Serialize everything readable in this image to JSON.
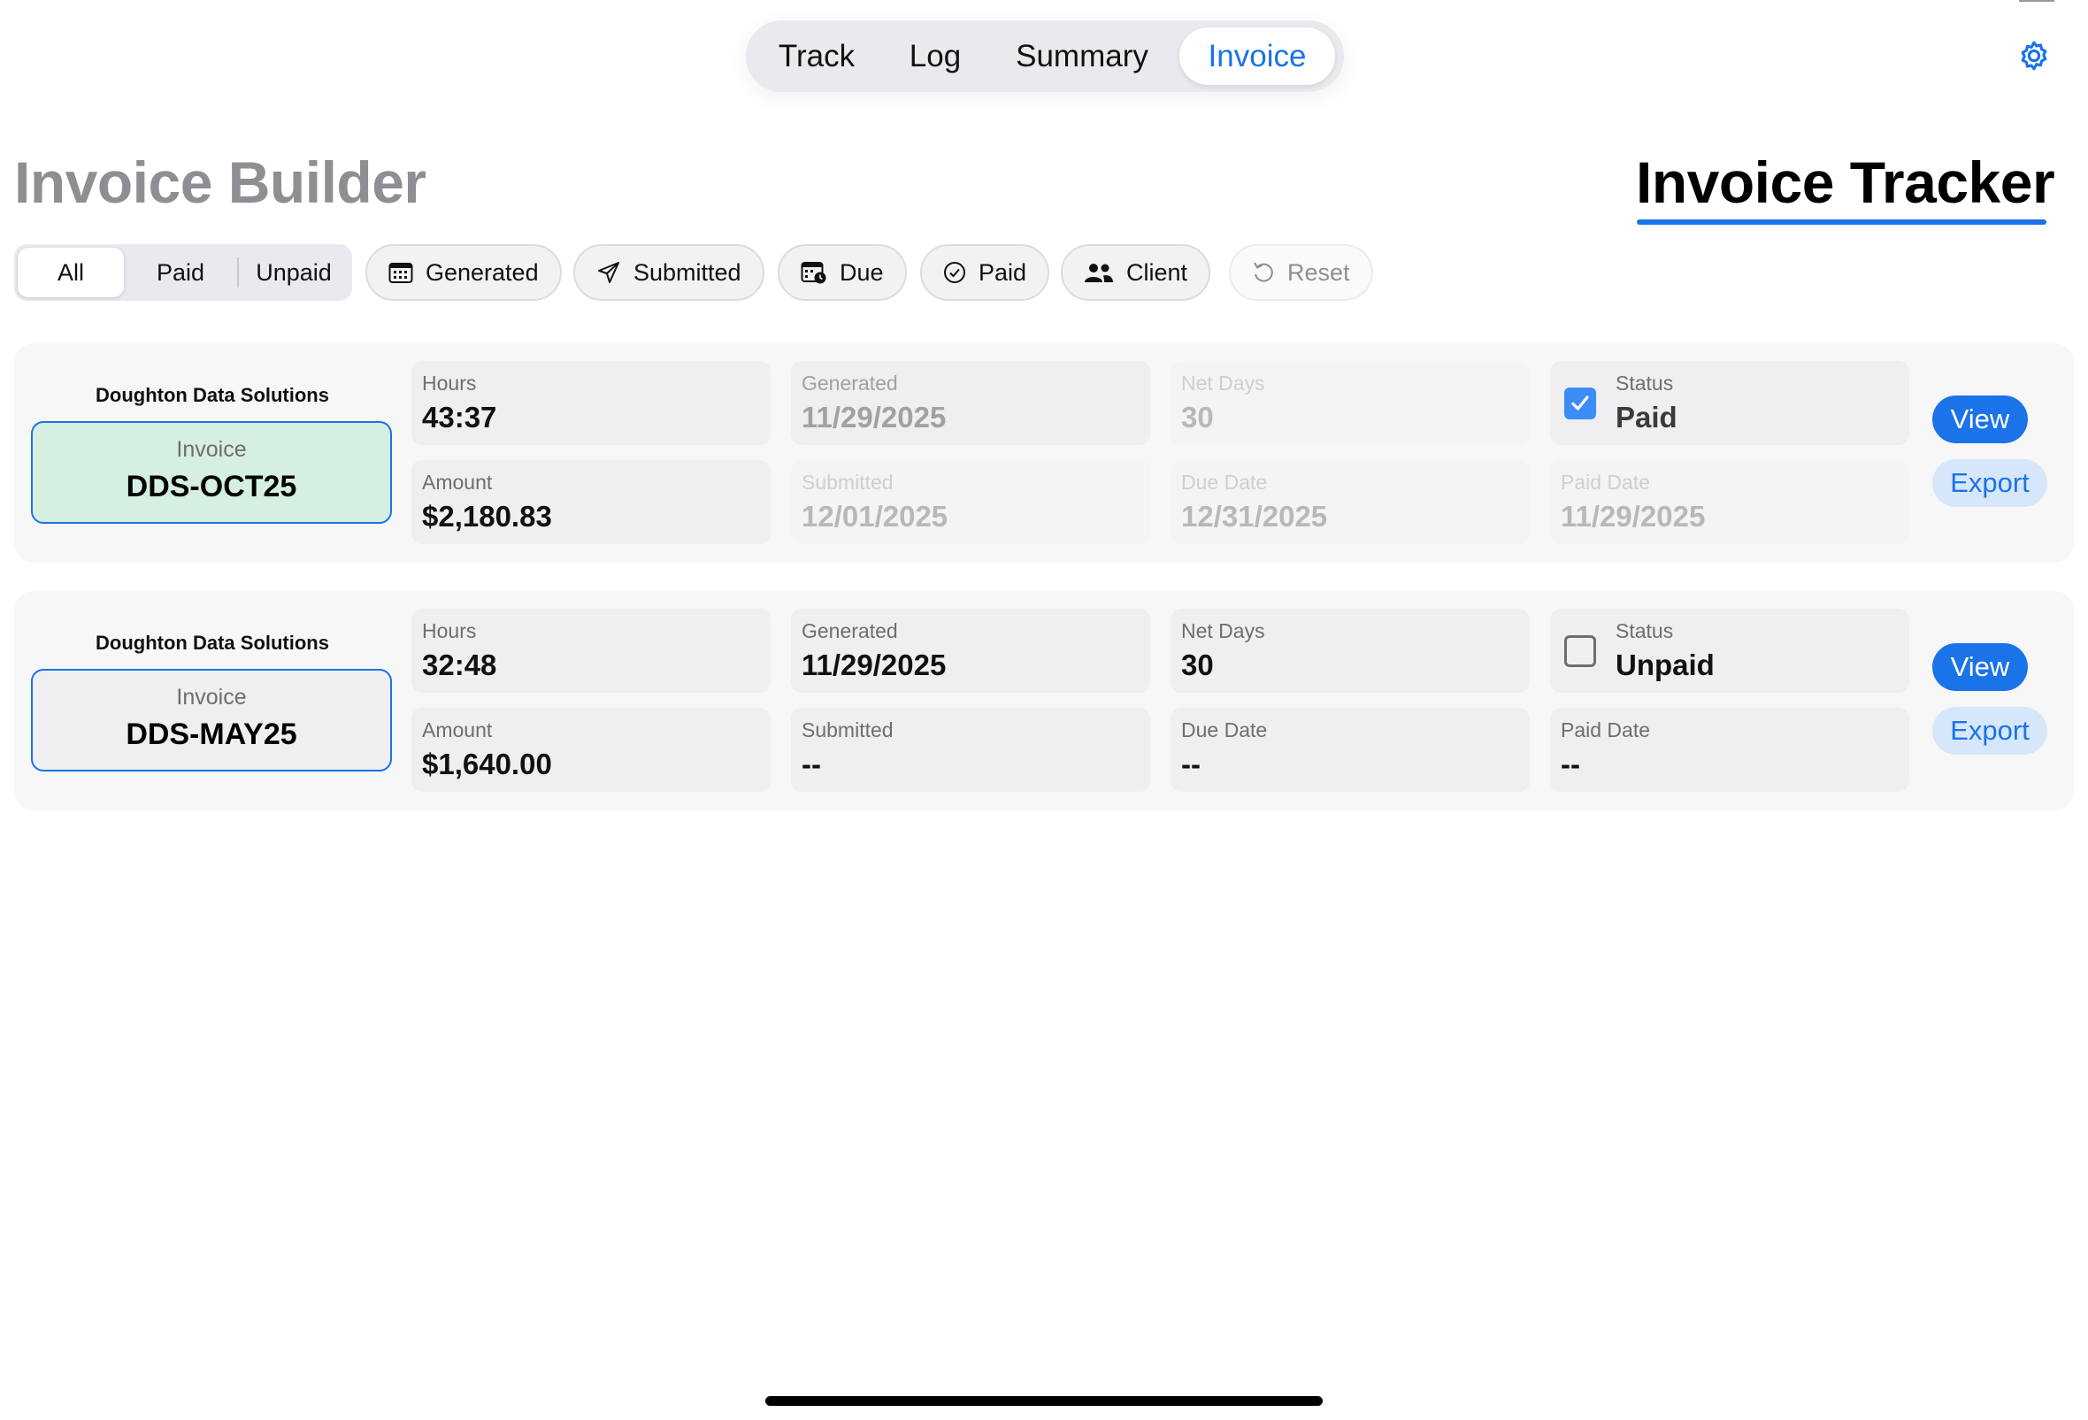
{
  "nav": {
    "tabs": [
      "Track",
      "Log",
      "Summary",
      "Invoice"
    ],
    "active": "Invoice"
  },
  "header": {
    "builder_title": "Invoice Builder",
    "tracker_title": "Invoice Tracker",
    "settings_icon": "gear-icon"
  },
  "filters": {
    "segment": [
      "All",
      "Paid",
      "Unpaid"
    ],
    "segment_selected": "All",
    "chips": [
      {
        "label": "Generated",
        "icon": "calendar-icon"
      },
      {
        "label": "Submitted",
        "icon": "paper-plane-icon"
      },
      {
        "label": "Due",
        "icon": "calendar-clock-icon"
      },
      {
        "label": "Paid",
        "icon": "check-circle-icon"
      },
      {
        "label": "Client",
        "icon": "people-icon"
      },
      {
        "label": "Reset",
        "icon": "undo-icon"
      }
    ]
  },
  "invoices": [
    {
      "client": "Doughton Data Solutions",
      "invoice_label": "Invoice",
      "invoice_number": "DDS-OCT25",
      "hours_label": "Hours",
      "hours": "43:37",
      "amount_label": "Amount",
      "amount": "$2,180.83",
      "generated_label": "Generated",
      "generated": "11/29/2025",
      "submitted_label": "Submitted",
      "submitted": "12/01/2025",
      "net_days_label": "Net Days",
      "net_days": "30",
      "due_label": "Due Date",
      "due": "12/31/2025",
      "status_label": "Status",
      "status": "Paid",
      "status_checked": true,
      "paid_date_label": "Paid Date",
      "paid_date": "11/29/2025",
      "view_label": "View",
      "export_label": "Export"
    },
    {
      "client": "Doughton Data Solutions",
      "invoice_label": "Invoice",
      "invoice_number": "DDS-MAY25",
      "hours_label": "Hours",
      "hours": "32:48",
      "amount_label": "Amount",
      "amount": "$1,640.00",
      "generated_label": "Generated",
      "generated": "11/29/2025",
      "submitted_label": "Submitted",
      "submitted": "--",
      "net_days_label": "Net Days",
      "net_days": "30",
      "due_label": "Due Date",
      "due": "--",
      "status_label": "Status",
      "status": "Unpaid",
      "status_checked": false,
      "paid_date_label": "Paid Date",
      "paid_date": "--",
      "view_label": "View",
      "export_label": "Export"
    }
  ],
  "colors": {
    "accent": "#1a73e8",
    "paid_invoice_bg": "#d5efe0",
    "card_bg": "#f7f7f8"
  }
}
